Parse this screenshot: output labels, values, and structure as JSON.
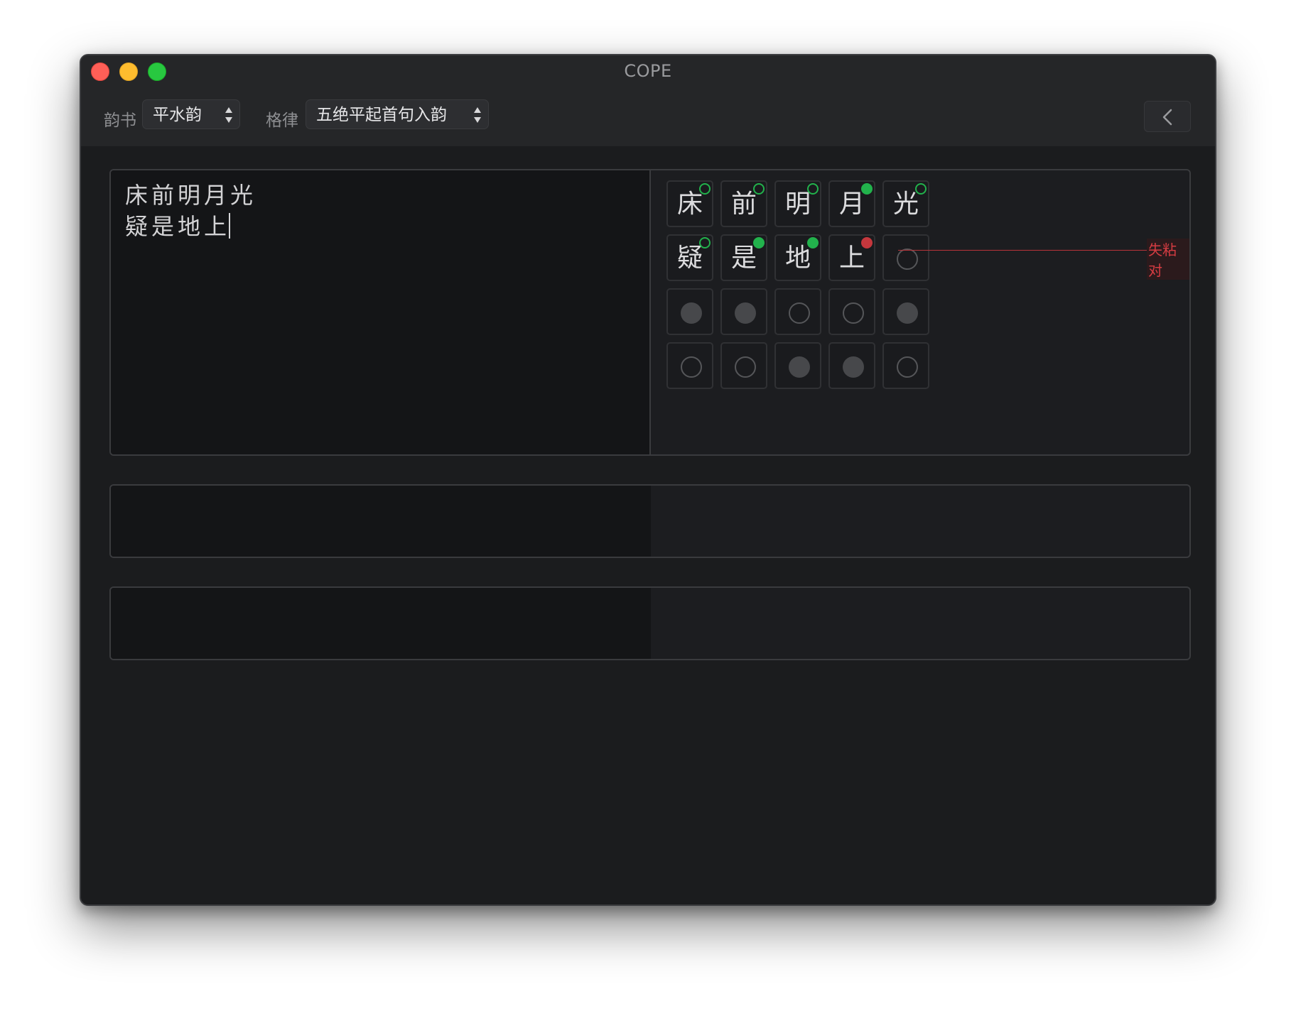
{
  "window": {
    "title": "COPE"
  },
  "toolbar": {
    "rhyme_book_label": "韵书",
    "rhyme_book_value": "平水韵",
    "meter_label": "格律",
    "meter_value": "五绝平起首句入韵",
    "back_icon": "chevron-left-icon"
  },
  "editor": {
    "lines": [
      "床前明月光",
      "疑是地上"
    ]
  },
  "grid": {
    "rows": [
      [
        {
          "char": "床",
          "indicator": "ring-green"
        },
        {
          "char": "前",
          "indicator": "ring-green"
        },
        {
          "char": "明",
          "indicator": "ring-green"
        },
        {
          "char": "月",
          "indicator": "fill-green"
        },
        {
          "char": "光",
          "indicator": "ring-green"
        }
      ],
      [
        {
          "char": "疑",
          "indicator": "ring-green"
        },
        {
          "char": "是",
          "indicator": "fill-green"
        },
        {
          "char": "地",
          "indicator": "fill-green"
        },
        {
          "char": "上",
          "indicator": "fill-red"
        },
        {
          "char": "",
          "mark": "open"
        }
      ],
      [
        {
          "char": "",
          "mark": "filled"
        },
        {
          "char": "",
          "mark": "filled"
        },
        {
          "char": "",
          "mark": "open"
        },
        {
          "char": "",
          "mark": "open"
        },
        {
          "char": "",
          "mark": "filled"
        }
      ],
      [
        {
          "char": "",
          "mark": "open"
        },
        {
          "char": "",
          "mark": "open"
        },
        {
          "char": "",
          "mark": "filled"
        },
        {
          "char": "",
          "mark": "filled"
        },
        {
          "char": "",
          "mark": "open"
        }
      ]
    ],
    "error_label": "失粘对"
  },
  "colors": {
    "ok": "#22b24c",
    "error": "#c5373d"
  }
}
